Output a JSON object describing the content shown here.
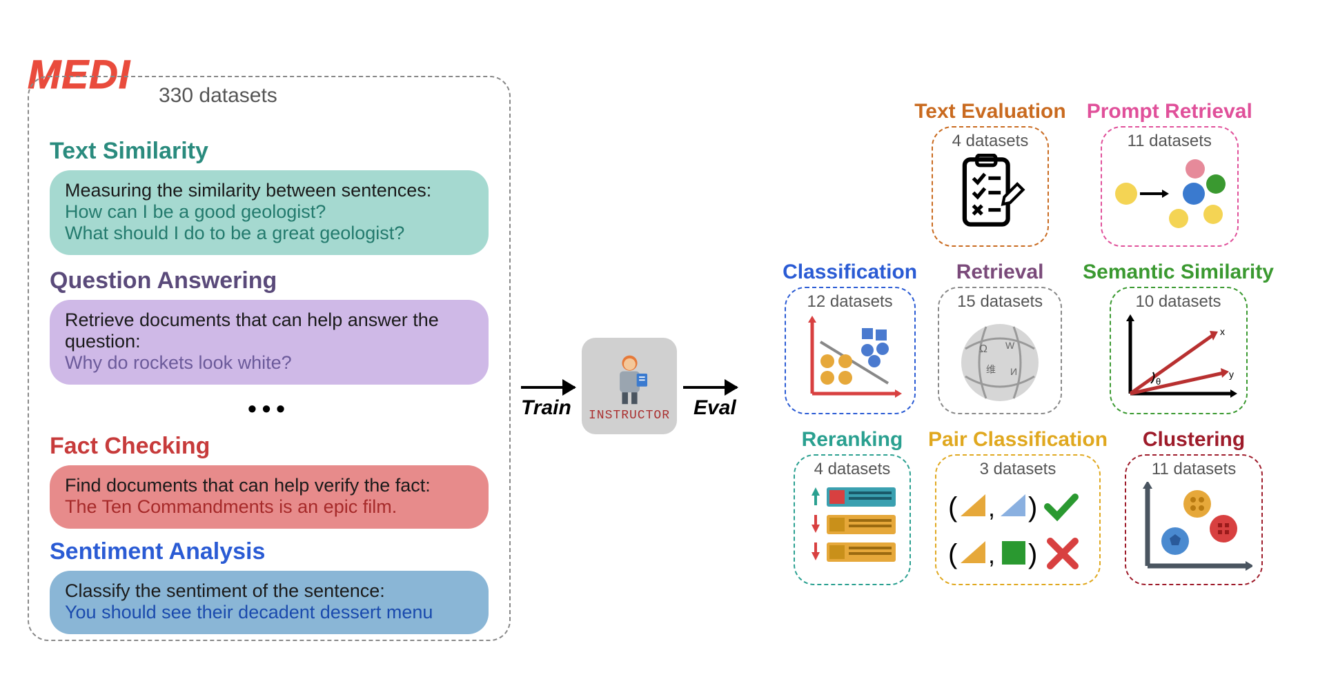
{
  "medi": {
    "label": "MEDI",
    "count": "330 datasets",
    "sections": {
      "ts": {
        "title": "Text Similarity",
        "instr": "Measuring the similarity between sentences:",
        "ex1": "How can I be a good geologist?",
        "ex2": "What should I do to be a great geologist?"
      },
      "qa": {
        "title": "Question Answering",
        "instr": "Retrieve documents that can help answer the question:",
        "ex": "Why do rockets look white?"
      },
      "fc": {
        "title": "Fact Checking",
        "instr": "Find documents that can help verify the fact:",
        "ex": "The Ten Commandments is an epic film."
      },
      "sa": {
        "title": "Sentiment Analysis",
        "instr": "Classify the sentiment of the sentence:",
        "ex": "You should see their decadent dessert menu"
      }
    }
  },
  "flow": {
    "train": "Train",
    "eval": "Eval",
    "instructor": "INSTRUCTOR"
  },
  "eval": {
    "te": {
      "title": "Text Evaluation",
      "count": "4 datasets"
    },
    "pr": {
      "title": "Prompt Retrieval",
      "count": "11 datasets"
    },
    "cl": {
      "title": "Classification",
      "count": "12 datasets"
    },
    "rt": {
      "title": "Retrieval",
      "count": "15 datasets"
    },
    "ss": {
      "title": "Semantic Similarity",
      "count": "10 datasets"
    },
    "rr": {
      "title": "Reranking",
      "count": "4 datasets"
    },
    "pc": {
      "title": "Pair Classification",
      "count": "3 datasets"
    },
    "cg": {
      "title": "Clustering",
      "count": "11 datasets"
    }
  }
}
